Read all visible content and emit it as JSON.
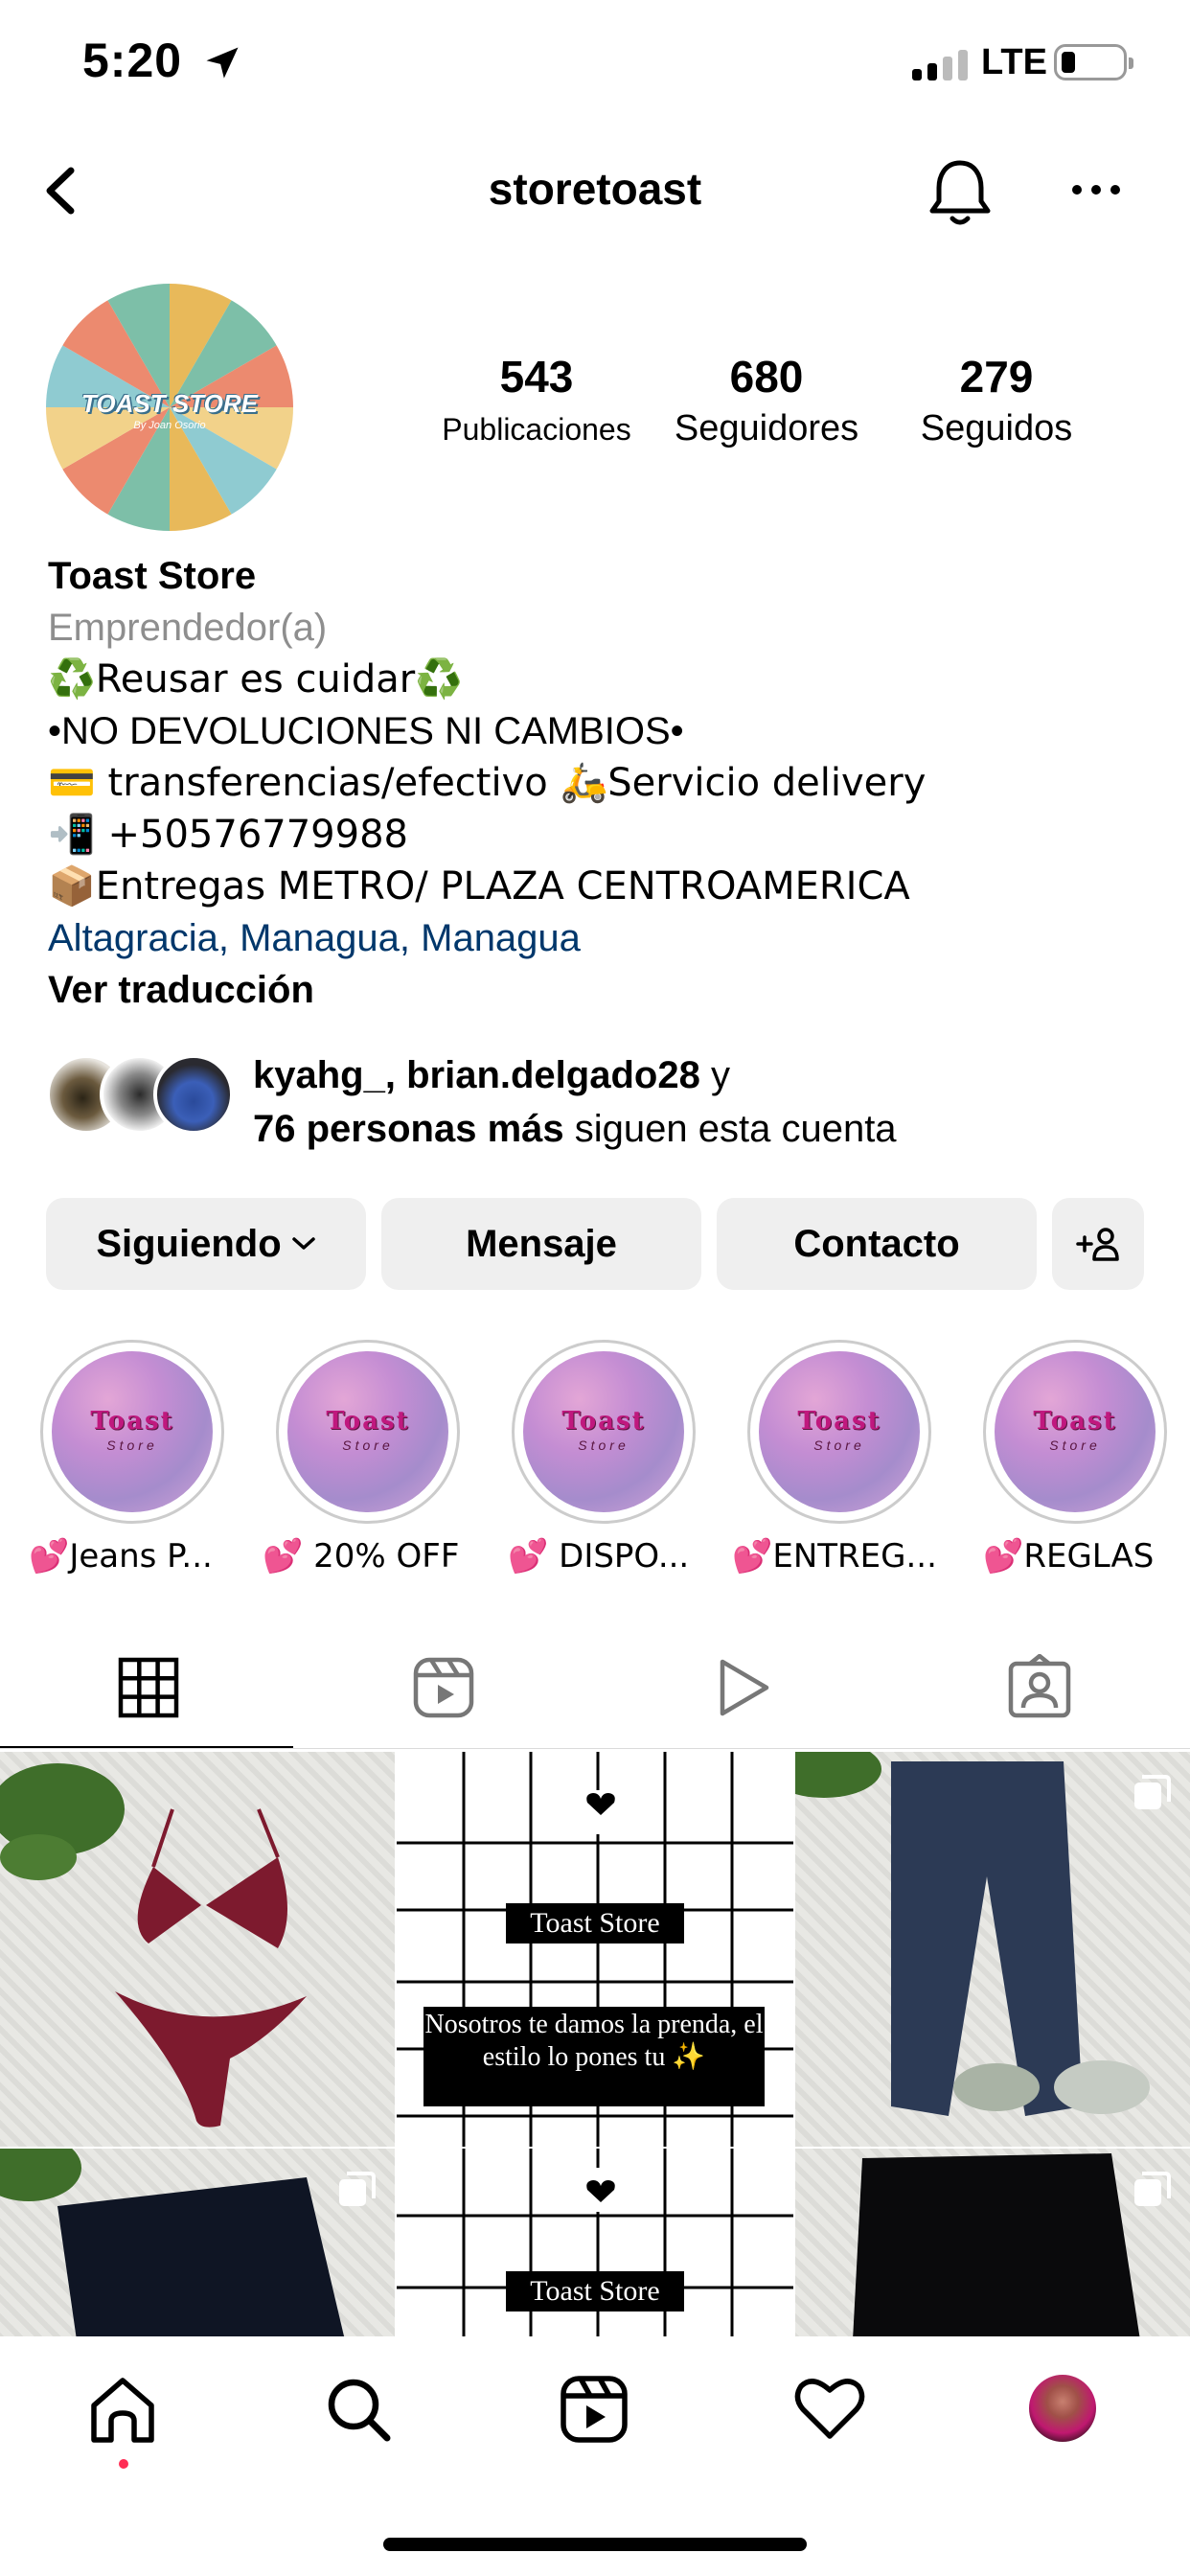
{
  "status_bar": {
    "time": "5:20",
    "network": "LTE",
    "location_icon": "location-arrow-icon",
    "signal_icon": "signal-bars-icon",
    "battery_icon": "battery-low-icon"
  },
  "header": {
    "username": "storetoast",
    "back_icon": "chevron-left-icon",
    "bell_icon": "bell-icon",
    "more_icon": "ellipsis-icon"
  },
  "profile": {
    "avatar_text": "TOAST STORE",
    "avatar_subtext": "By Joan Osorio",
    "stats": [
      {
        "value": "543",
        "label": "Publicaciones"
      },
      {
        "value": "680",
        "label": "Seguidores"
      },
      {
        "value": "279",
        "label": "Seguidos"
      }
    ],
    "name": "Toast Store",
    "category": "Emprendedor(a)",
    "bio_lines": [
      "♻️Reusar es cuidar♻️",
      "•NO DEVOLUCIONES NI CAMBIOS•",
      "💳 transferencias/efectivo 🛵Servicio delivery",
      "📲 +50576779988",
      "📦Entregas METRO/ PLAZA CENTROAMERICA"
    ],
    "location": "Altagracia, Managua, Managua",
    "translate": "Ver traducción"
  },
  "followed_by": {
    "names": "kyahg_, brian.delgado28",
    "conjunction": " y",
    "more": "76 personas más",
    "suffix": " siguen esta cuenta"
  },
  "buttons": {
    "following": "Siguiendo",
    "message": "Mensaje",
    "contact": "Contacto",
    "add_user_icon": "add-person-icon"
  },
  "highlights": [
    {
      "label": "💕Jeans P...",
      "logo": "Toast",
      "logo_sub": "Store"
    },
    {
      "label": "💕 20% OFF",
      "logo": "Toast",
      "logo_sub": "Store"
    },
    {
      "label": "💕 DISPO...",
      "logo": "Toast",
      "logo_sub": "Store"
    },
    {
      "label": "💕ENTREG...",
      "logo": "Toast",
      "logo_sub": "Store"
    },
    {
      "label": "💕REGLAS",
      "logo": "Toast",
      "logo_sub": "Store"
    }
  ],
  "tabs": [
    "grid-icon",
    "reels-icon",
    "play-icon",
    "tagged-icon"
  ],
  "grid": {
    "post2_title": "Toast Store",
    "post2_caption": "Nosotros te damos la prenda, el estilo lo pones tu ✨",
    "post5_title": "Toast Store"
  },
  "bottom_nav": [
    "home-icon",
    "search-icon",
    "reels-icon",
    "heart-icon",
    "profile-avatar"
  ]
}
